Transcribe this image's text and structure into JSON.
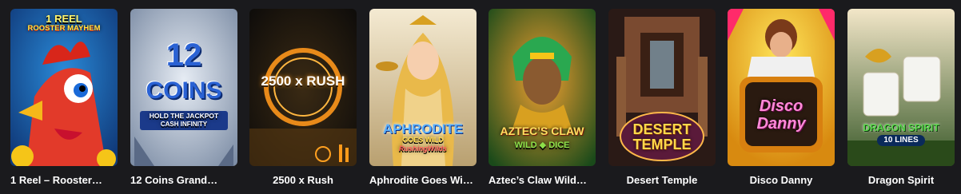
{
  "games": [
    {
      "name": "1 Reel – Rooster…",
      "art_lines": [
        "1 REEL",
        "ROOSTER MAYHEM"
      ]
    },
    {
      "name": "12 Coins Grand…",
      "art_lines": [
        "12",
        "COINS",
        "HOLD THE JACKPOT",
        "CASH INFINITY"
      ]
    },
    {
      "name": "2500 x Rush",
      "art_lines": [
        "2500 x RUSH"
      ]
    },
    {
      "name": "Aphrodite Goes Wi…",
      "art_lines": [
        "APHRODITE",
        "GOES WILD",
        "RushingWilds"
      ]
    },
    {
      "name": "Aztec’s Claw Wild…",
      "art_lines": [
        "AZTEC’S CLAW",
        "WILD ◆ DICE"
      ]
    },
    {
      "name": "Desert Temple",
      "art_lines": [
        "DESERT",
        "TEMPLE"
      ]
    },
    {
      "name": "Disco Danny",
      "art_lines": [
        "Disco",
        "Danny"
      ]
    },
    {
      "name": "Dragon Spirit",
      "art_lines": [
        "DRAGON SPIRIT",
        "10 LINES"
      ]
    }
  ]
}
